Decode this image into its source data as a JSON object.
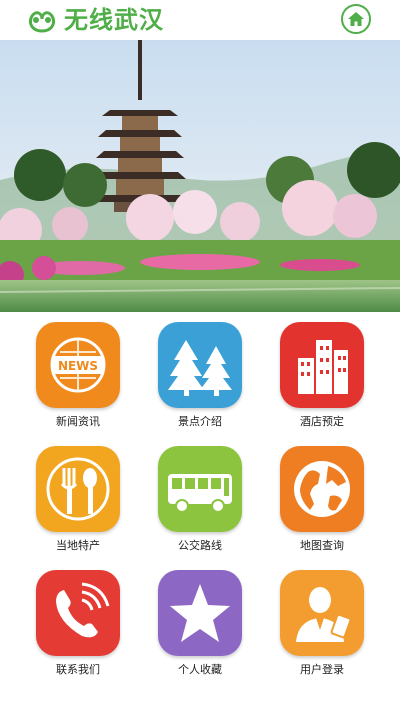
{
  "header": {
    "title": "无线武汉",
    "logo_icon": "leaf-logo-icon",
    "home_icon": "home-icon",
    "accent_color": "#4fae47"
  },
  "banner": {
    "description_icon": "pagoda-photo"
  },
  "menu": [
    {
      "label": "新闻资讯",
      "icon": "news-icon",
      "color": "#f08a1d",
      "badge_text": "NEWS"
    },
    {
      "label": "景点介绍",
      "icon": "trees-icon",
      "color": "#3ba0d6"
    },
    {
      "label": "酒店预定",
      "icon": "buildings-icon",
      "color": "#e2332f"
    },
    {
      "label": "当地特产",
      "icon": "fork-spoon-icon",
      "color": "#f2a51f"
    },
    {
      "label": "公交路线",
      "icon": "bus-icon",
      "color": "#8cc43f"
    },
    {
      "label": "地图查询",
      "icon": "globe-icon",
      "color": "#ef7d22"
    },
    {
      "label": "联系我们",
      "icon": "phone-icon",
      "color": "#e43b34"
    },
    {
      "label": "个人收藏",
      "icon": "star-icon",
      "color": "#8c67c3"
    },
    {
      "label": "用户登录",
      "icon": "user-icon",
      "color": "#f39c2f"
    }
  ]
}
